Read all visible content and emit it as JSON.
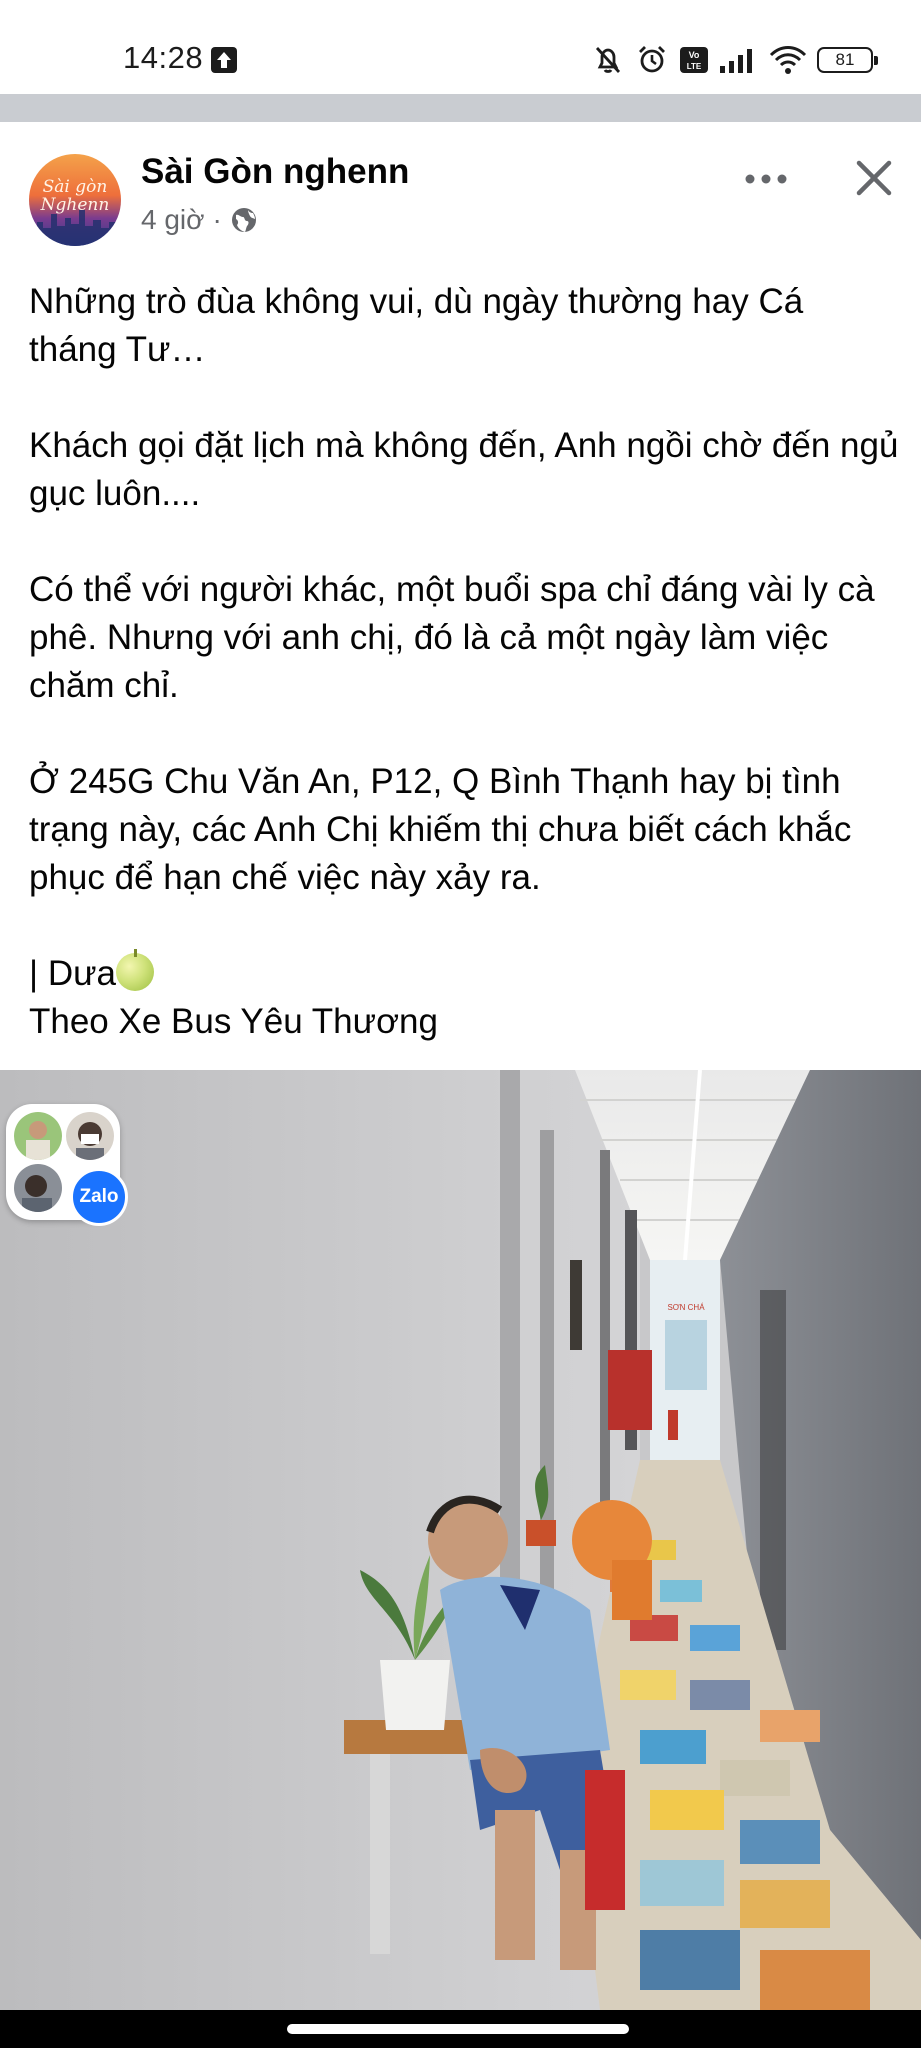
{
  "status_bar": {
    "time": "14:28",
    "battery": "81",
    "icons": [
      "upload-icon",
      "mute-bell-icon",
      "alarm-icon",
      "volte-icon",
      "signal-icon",
      "wifi-icon",
      "battery-icon"
    ]
  },
  "post": {
    "page_name": "Sài Gòn nghenn",
    "time_ago": "4 giờ",
    "separator": "·",
    "audience_icon": "globe-icon",
    "avatar_text": "Sài gòn Nghenn",
    "paragraphs": {
      "p1": "Những trò đùa không vui, dù ngày thường hay Cá tháng Tư…",
      "p2": "Khách gọi đặt lịch mà không đến, Anh ngồi chờ đến ngủ gục luôn....",
      "p3": "Có thể với người khác, một buổi spa chỉ đáng vài ly cà phê. Nhưng với anh chị, đó là cả một ngày làm việc chăm chỉ.",
      "p4": "Ở 245G Chu Văn An, P12, Q Bình Thạnh hay bị tình trạng này, các Anh Chị khiếm thị chưa biết cách khắc phục để hạn chế việc này xảy ra.",
      "signature": "| Dưa",
      "source": "Theo Xe Bus Yêu Thương"
    }
  },
  "photo": {
    "sign_text": "SƠN CHÁ"
  },
  "zalo_bubble": {
    "label": "Zalo"
  },
  "colors": {
    "text": "#050505",
    "secondary_text": "#65676b",
    "divider": "#c9ccd1",
    "zalo_blue": "#1a73ff"
  }
}
